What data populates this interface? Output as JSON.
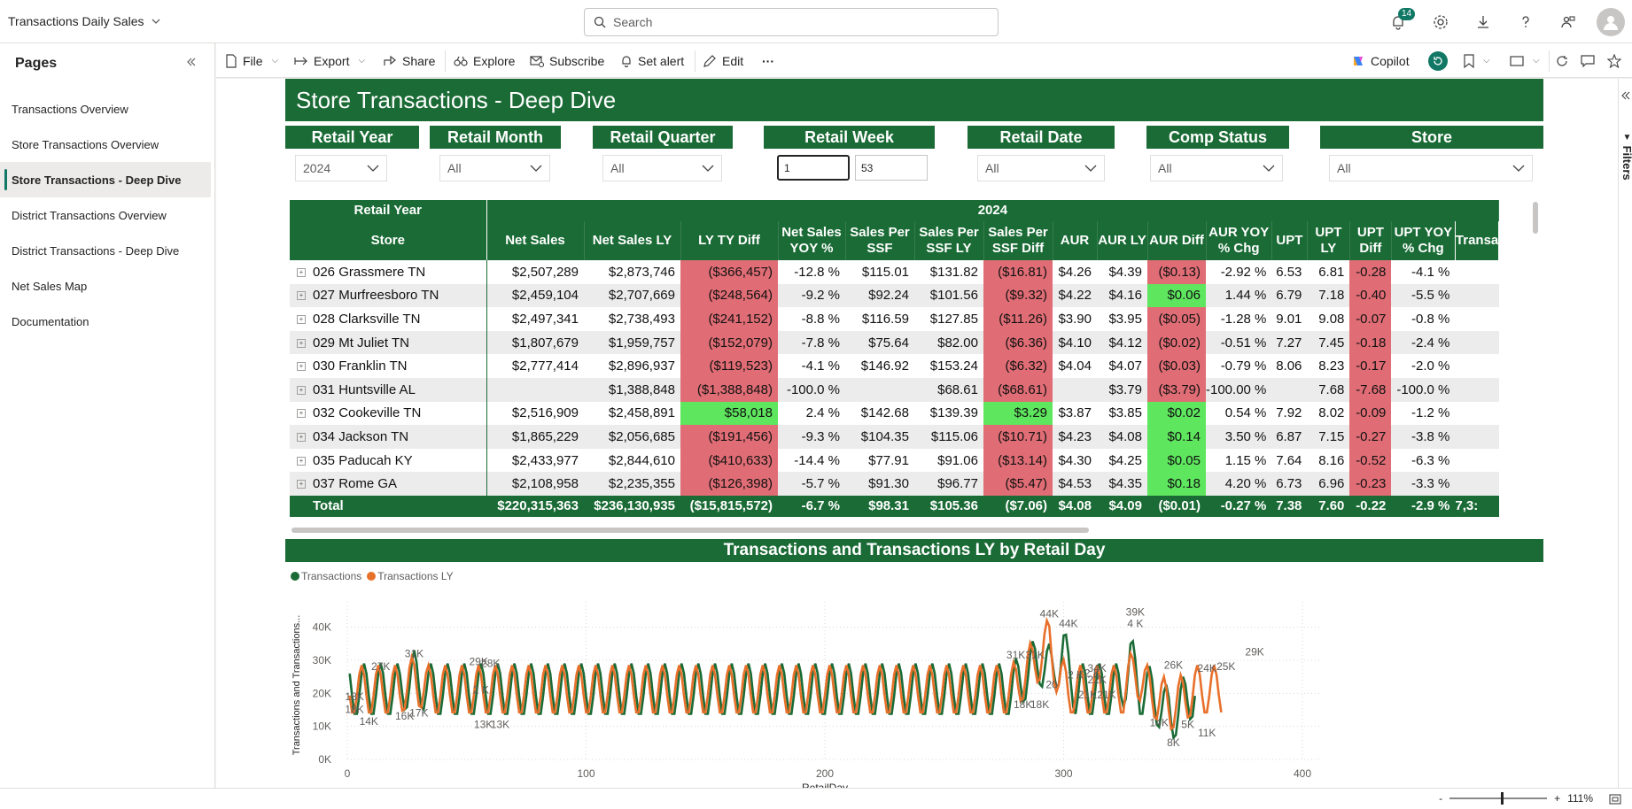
{
  "app": {
    "title": "Transactions Daily Sales"
  },
  "search": {
    "placeholder": "Search"
  },
  "notifications": {
    "count": "14"
  },
  "pages": {
    "title": "Pages",
    "items": [
      "Transactions Overview",
      "Store Transactions Overview",
      "Store Transactions - Deep Dive",
      "District Transactions Overview",
      "District Transactions - Deep Dive",
      "Net Sales Map",
      "Documentation"
    ],
    "active_index": 2
  },
  "actions": {
    "file": "File",
    "export": "Export",
    "share": "Share",
    "explore": "Explore",
    "subscribe": "Subscribe",
    "set_alert": "Set alert",
    "edit": "Edit",
    "more": "···",
    "copilot": "Copilot"
  },
  "report": {
    "title": "Store Transactions - Deep Dive"
  },
  "slicers": {
    "retail_year": {
      "label": "Retail Year",
      "value": "2024"
    },
    "retail_month": {
      "label": "Retail Month",
      "value": "All"
    },
    "retail_quarter": {
      "label": "Retail Quarter",
      "value": "All"
    },
    "retail_week": {
      "label": "Retail Week",
      "min": "1",
      "max": "53"
    },
    "retail_date": {
      "label": "Retail Date",
      "value": "All"
    },
    "comp_status": {
      "label": "Comp Status",
      "value": "All"
    },
    "store": {
      "label": "Store",
      "value": "All"
    }
  },
  "matrix": {
    "year_label": "Retail Year",
    "year_value": "2024",
    "columns": [
      "Store",
      "Net Sales",
      "Net Sales LY",
      "LY TY Diff",
      "Net Sales YOY %",
      "Sales Per SSF",
      "Sales Per SSF LY",
      "Sales Per SSF Diff",
      "AUR",
      "AUR LY",
      "AUR Diff",
      "AUR YOY % Chg",
      "UPT",
      "UPT LY",
      "UPT Diff",
      "UPT YOY % Chg",
      "Transa"
    ],
    "rows": [
      [
        "026 Grassmere TN",
        "$2,507,289",
        "$2,873,746",
        "($366,457)",
        "-12.8 %",
        "$115.01",
        "$131.82",
        "($16.81)",
        "$4.26",
        "$4.39",
        "($0.13)",
        "-2.92 %",
        "6.53",
        "6.81",
        "-0.28",
        "-4.1 %",
        ""
      ],
      [
        "027 Murfreesboro TN",
        "$2,459,104",
        "$2,707,669",
        "($248,564)",
        "-9.2 %",
        "$92.24",
        "$101.56",
        "($9.32)",
        "$4.22",
        "$4.16",
        "$0.06",
        "1.44 %",
        "6.79",
        "7.18",
        "-0.40",
        "-5.5 %",
        ""
      ],
      [
        "028 Clarksville TN",
        "$2,497,341",
        "$2,738,493",
        "($241,152)",
        "-8.8 %",
        "$116.59",
        "$127.85",
        "($11.26)",
        "$3.90",
        "$3.95",
        "($0.05)",
        "-1.28 %",
        "9.01",
        "9.08",
        "-0.07",
        "-0.8 %",
        ""
      ],
      [
        "029 Mt Juliet TN",
        "$1,807,679",
        "$1,959,757",
        "($152,079)",
        "-7.8 %",
        "$75.64",
        "$82.00",
        "($6.36)",
        "$4.10",
        "$4.12",
        "($0.02)",
        "-0.51 %",
        "7.27",
        "7.45",
        "-0.18",
        "-2.4 %",
        ""
      ],
      [
        "030 Franklin TN",
        "$2,777,414",
        "$2,896,937",
        "($119,523)",
        "-4.1 %",
        "$146.92",
        "$153.24",
        "($6.32)",
        "$4.04",
        "$4.07",
        "($0.03)",
        "-0.79 %",
        "8.06",
        "8.23",
        "-0.17",
        "-2.0 %",
        ""
      ],
      [
        "031 Huntsville AL",
        "",
        "$1,388,848",
        "($1,388,848)",
        "-100.0 %",
        "",
        "$68.61",
        "($68.61)",
        "",
        "$3.79",
        "($3.79)",
        "-100.00 %",
        "",
        "7.68",
        "-7.68",
        "-100.0 %",
        ""
      ],
      [
        "032 Cookeville TN",
        "$2,516,909",
        "$2,458,891",
        "$58,018",
        "2.4 %",
        "$142.68",
        "$139.39",
        "$3.29",
        "$3.87",
        "$3.85",
        "$0.02",
        "0.54 %",
        "7.92",
        "8.02",
        "-0.09",
        "-1.2 %",
        ""
      ],
      [
        "034 Jackson TN",
        "$1,865,229",
        "$2,056,685",
        "($191,456)",
        "-9.3 %",
        "$104.35",
        "$115.06",
        "($10.71)",
        "$4.23",
        "$4.08",
        "$0.14",
        "3.50 %",
        "6.87",
        "7.15",
        "-0.27",
        "-3.8 %",
        ""
      ],
      [
        "035 Paducah KY",
        "$2,433,977",
        "$2,844,610",
        "($410,633)",
        "-14.4 %",
        "$77.91",
        "$91.06",
        "($13.14)",
        "$4.30",
        "$4.25",
        "$0.05",
        "1.15 %",
        "7.64",
        "8.16",
        "-0.52",
        "-6.3 %",
        ""
      ],
      [
        "037 Rome GA",
        "$2,108,958",
        "$2,235,355",
        "($126,398)",
        "-5.7 %",
        "$91.30",
        "$96.77",
        "($5.47)",
        "$4.53",
        "$4.35",
        "$0.18",
        "4.20 %",
        "6.73",
        "6.96",
        "-0.23",
        "-3.3 %",
        ""
      ]
    ],
    "total": [
      "Total",
      "$220,315,363",
      "$236,130,935",
      "($15,815,572)",
      "-6.7 %",
      "$98.31",
      "$105.36",
      "($7.06)",
      "$4.08",
      "$4.09",
      "($0.01)",
      "-0.27 %",
      "7.38",
      "7.60",
      "-0.22",
      "-2.9 %",
      "7,3:"
    ]
  },
  "colors": {
    "header_green": "#1a6b35",
    "negative": "#e06d75",
    "positive": "#5ee65e",
    "series_ty": "#1a6b35",
    "series_ly": "#e8702a"
  },
  "chart_data": {
    "type": "line",
    "title": "Transactions and Transactions LY by Retail Day",
    "xlabel": "RetailDay",
    "ylabel": "Transactions and Transactions...",
    "xlim": [
      0,
      400
    ],
    "ylim": [
      0,
      45000
    ],
    "x_ticks": [
      "0",
      "100",
      "200",
      "300",
      "400"
    ],
    "y_ticks": [
      "0K",
      "10K",
      "20K",
      "30K",
      "40K"
    ],
    "legend_position": "top-left",
    "series": [
      {
        "name": "Transactions",
        "color": "#1a6b35"
      },
      {
        "name": "Transactions LY",
        "color": "#e8702a"
      }
    ],
    "annotations": [
      {
        "x": 3,
        "y": 18000,
        "label": "18K"
      },
      {
        "x": 3,
        "y": 14000,
        "label": "18K"
      },
      {
        "x": 9,
        "y": 10500,
        "label": "14K"
      },
      {
        "x": 14,
        "y": 27000,
        "label": "27K"
      },
      {
        "x": 24,
        "y": 12000,
        "label": "16K"
      },
      {
        "x": 28,
        "y": 31000,
        "label": "31K"
      },
      {
        "x": 30,
        "y": 13000,
        "label": "17K"
      },
      {
        "x": 55,
        "y": 28500,
        "label": "29K"
      },
      {
        "x": 56,
        "y": 20000,
        "label": "2 K"
      },
      {
        "x": 60,
        "y": 28000,
        "label": "28K"
      },
      {
        "x": 57,
        "y": 9500,
        "label": "13K"
      },
      {
        "x": 64,
        "y": 9500,
        "label": "13K"
      },
      {
        "x": 280,
        "y": 30500,
        "label": "31K"
      },
      {
        "x": 288,
        "y": 30500,
        "label": "31K"
      },
      {
        "x": 283,
        "y": 15500,
        "label": "18K"
      },
      {
        "x": 290,
        "y": 15500,
        "label": "18K"
      },
      {
        "x": 294,
        "y": 43000,
        "label": "44K"
      },
      {
        "x": 302,
        "y": 40000,
        "label": "44K"
      },
      {
        "x": 295,
        "y": 21500,
        "label": "20"
      },
      {
        "x": 305,
        "y": 24500,
        "label": "2 K"
      },
      {
        "x": 314,
        "y": 26500,
        "label": "34K"
      },
      {
        "x": 312,
        "y": 25000,
        "label": "2 K"
      },
      {
        "x": 310,
        "y": 18500,
        "label": "21K"
      },
      {
        "x": 318,
        "y": 18500,
        "label": "21K"
      },
      {
        "x": 314,
        "y": 23000,
        "label": "22K"
      },
      {
        "x": 330,
        "y": 43500,
        "label": "39K"
      },
      {
        "x": 330,
        "y": 40000,
        "label": "4 K"
      },
      {
        "x": 346,
        "y": 27500,
        "label": "26K"
      },
      {
        "x": 340,
        "y": 10000,
        "label": "14K"
      },
      {
        "x": 352,
        "y": 9500,
        "label": "5K"
      },
      {
        "x": 346,
        "y": 4000,
        "label": "8K"
      },
      {
        "x": 360,
        "y": 7000,
        "label": "11K"
      },
      {
        "x": 360,
        "y": 26500,
        "label": "24K"
      },
      {
        "x": 368,
        "y": 27000,
        "label": "25K"
      },
      {
        "x": 380,
        "y": 31500,
        "label": "29K"
      }
    ]
  }
}
